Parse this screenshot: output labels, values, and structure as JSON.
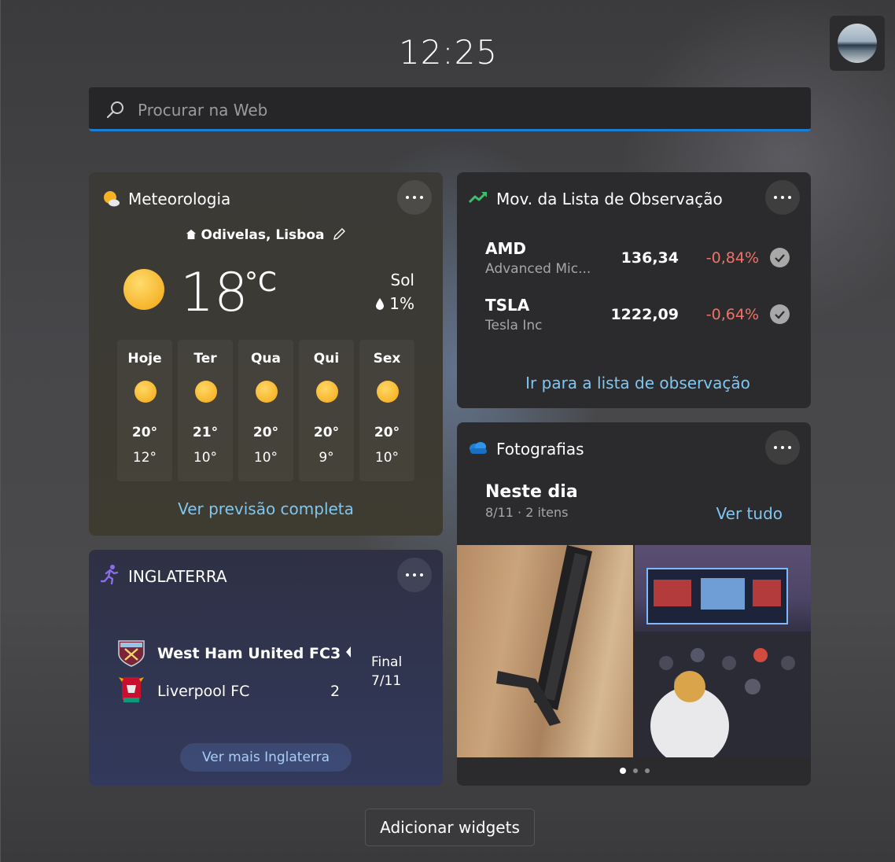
{
  "clock": "12:25",
  "search": {
    "placeholder": "Procurar na Web"
  },
  "weather": {
    "title": "Meteorologia",
    "location": "Odivelas, Lisboa",
    "temp": "18",
    "unit": "°C",
    "condition": "Sol",
    "precip": "1%",
    "days": [
      {
        "name": "Hoje",
        "high": "20°",
        "low": "12°"
      },
      {
        "name": "Ter",
        "high": "21°",
        "low": "10°"
      },
      {
        "name": "Qua",
        "high": "20°",
        "low": "10°"
      },
      {
        "name": "Qui",
        "high": "20°",
        "low": "9°"
      },
      {
        "name": "Sex",
        "high": "20°",
        "low": "10°"
      }
    ],
    "link": "Ver previsão completa"
  },
  "stocks": {
    "title": "Mov. da Lista de Observação",
    "items": [
      {
        "ticker": "AMD",
        "name": "Advanced Mic...",
        "price": "136,34",
        "change": "-0,84%"
      },
      {
        "ticker": "TSLA",
        "name": "Tesla Inc",
        "price": "1222,09",
        "change": "-0,64%"
      }
    ],
    "link": "Ir para a lista de observação"
  },
  "photos": {
    "title": "Fotografias",
    "heading": "Neste dia",
    "meta": "8/11 · 2 itens",
    "link": "Ver tudo"
  },
  "football": {
    "title": "INGLATERRA",
    "home": {
      "name": "West Ham United FC",
      "score": "3"
    },
    "away": {
      "name": "Liverpool FC",
      "score": "2"
    },
    "status": "Final",
    "date": "7/11",
    "link": "Ver mais Inglaterra"
  },
  "add_widgets": "Adicionar widgets",
  "colors": {
    "accent": "#1a7fd4",
    "negative": "#f07268",
    "link": "#7fc7f3"
  }
}
